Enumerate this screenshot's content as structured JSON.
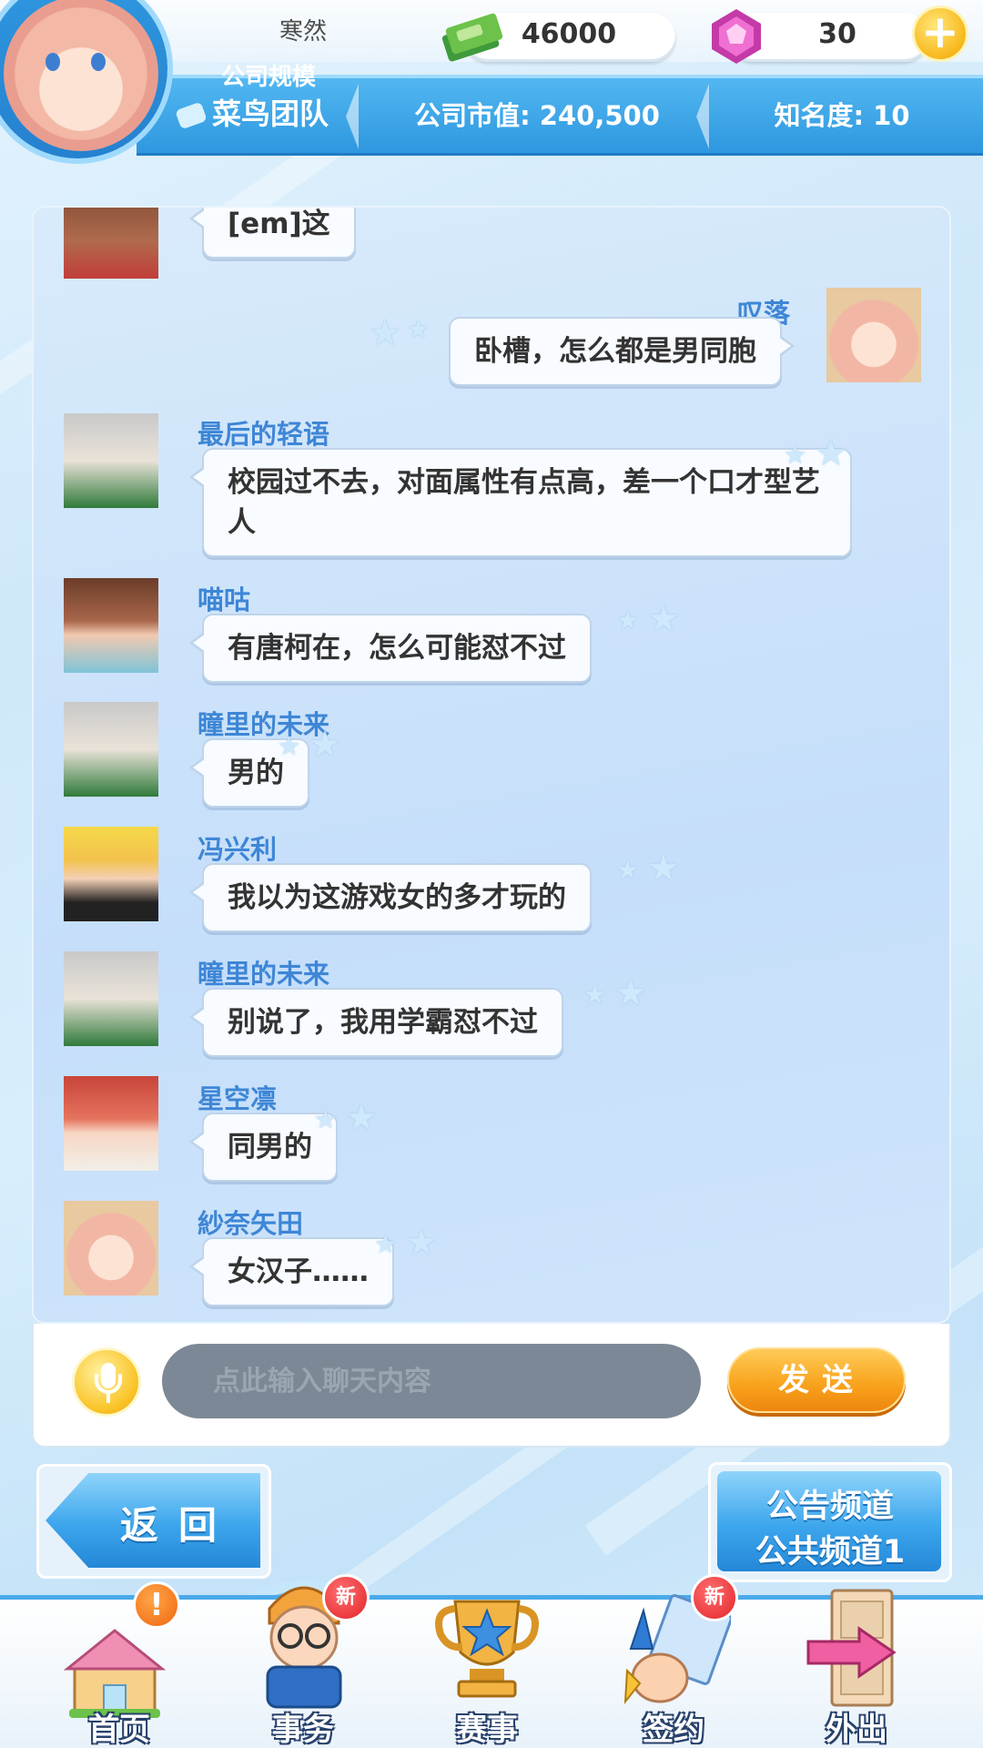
{
  "header": {
    "player_name": "寒然",
    "company_scale_label": "公司规模",
    "company_scale_value": "菜鸟团队",
    "money": "46000",
    "gems": "30",
    "market_value": "公司市值: 240,500",
    "fame": "知名度: 10",
    "plus_symbol": "+"
  },
  "chat": {
    "messages": [
      {
        "sender": "",
        "text": "[em]这",
        "side": "left",
        "avatar": "brown-hair-girl"
      },
      {
        "sender": "叹落",
        "text": "卧槽，怎么都是男同胞",
        "side": "right",
        "avatar": "pink-hair-girl"
      },
      {
        "sender": "最后的轻语",
        "text": "校园过不去，对面属性有点高，差一个口才型艺人",
        "side": "left",
        "avatar": "glasses-boy"
      },
      {
        "sender": "喵咕",
        "text": "有唐柯在，怎么可能怼不过",
        "side": "left",
        "avatar": "brown-hair-girl"
      },
      {
        "sender": "瞳里的未来",
        "text": "男的",
        "side": "left",
        "avatar": "glasses-boy"
      },
      {
        "sender": "冯兴利",
        "text": "我以为这游戏女的多才玩的",
        "side": "left",
        "avatar": "blonde-boy"
      },
      {
        "sender": "瞳里的未来",
        "text": "别说了，我用学霸怼不过",
        "side": "left",
        "avatar": "glasses-boy"
      },
      {
        "sender": "星空凛",
        "text": "同男的",
        "side": "left",
        "avatar": "red-hair-girl"
      },
      {
        "sender": "紗奈矢田",
        "text": "女汉子……",
        "side": "left",
        "avatar": "pink-hair-girl"
      }
    ]
  },
  "input": {
    "placeholder": "点此输入聊天内容",
    "send_label": "发送"
  },
  "actions": {
    "back_label": "返回",
    "channel_line1": "公告频道",
    "channel_line2": "公共频道1"
  },
  "nav": {
    "items": [
      {
        "label": "首页",
        "badge": "!"
      },
      {
        "label": "事务",
        "badge": "新"
      },
      {
        "label": "赛事",
        "badge": ""
      },
      {
        "label": "签约",
        "badge": "新"
      },
      {
        "label": "外出",
        "badge": ""
      }
    ]
  },
  "colors": {
    "accent_blue": "#3e86d6",
    "header_blue": "#2e97df",
    "send_orange": "#f8a11a",
    "badge_red": "#e2242a"
  }
}
